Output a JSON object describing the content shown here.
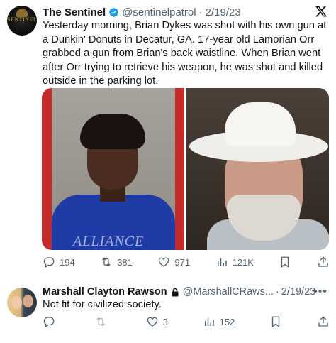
{
  "post": {
    "author_name": "The Sentinel",
    "handle": "@sentinelpatrol",
    "separator": "·",
    "date": "2/19/23",
    "avatar_text": "SENTINEL",
    "text": "Yesterday morning, Brian Dykes was shot with his own gun at a Dunkin' Donuts in Decatur, GA. 17-year old Lamorian Orr grabbed a gun from Brian's back waistline. When Brian went after Orr trying to retrieve his weapon, he was shot and killed outside in the parking lot.",
    "image_left_overlay": "ALLIANCE",
    "actions": {
      "replies": "194",
      "reposts": "381",
      "likes": "971",
      "views": "121K"
    }
  },
  "reply": {
    "author_name": "Marshall Clayton Rawson",
    "handle": "@MarshallCRaws...",
    "separator": "·",
    "date": "2/19/23",
    "text": "Not fit for civilized society.",
    "more": "•••",
    "actions": {
      "replies": "",
      "reposts": "",
      "likes": "3",
      "views": "152"
    }
  },
  "colors": {
    "verified": "#1d9bf0",
    "secondary_text": "#536471",
    "primary_text": "#0f1419"
  },
  "icons": [
    "x-logo-icon",
    "verified-badge-icon",
    "reply-icon",
    "repost-icon",
    "like-icon",
    "views-icon",
    "bookmark-icon",
    "share-icon",
    "lock-icon",
    "more-icon"
  ]
}
